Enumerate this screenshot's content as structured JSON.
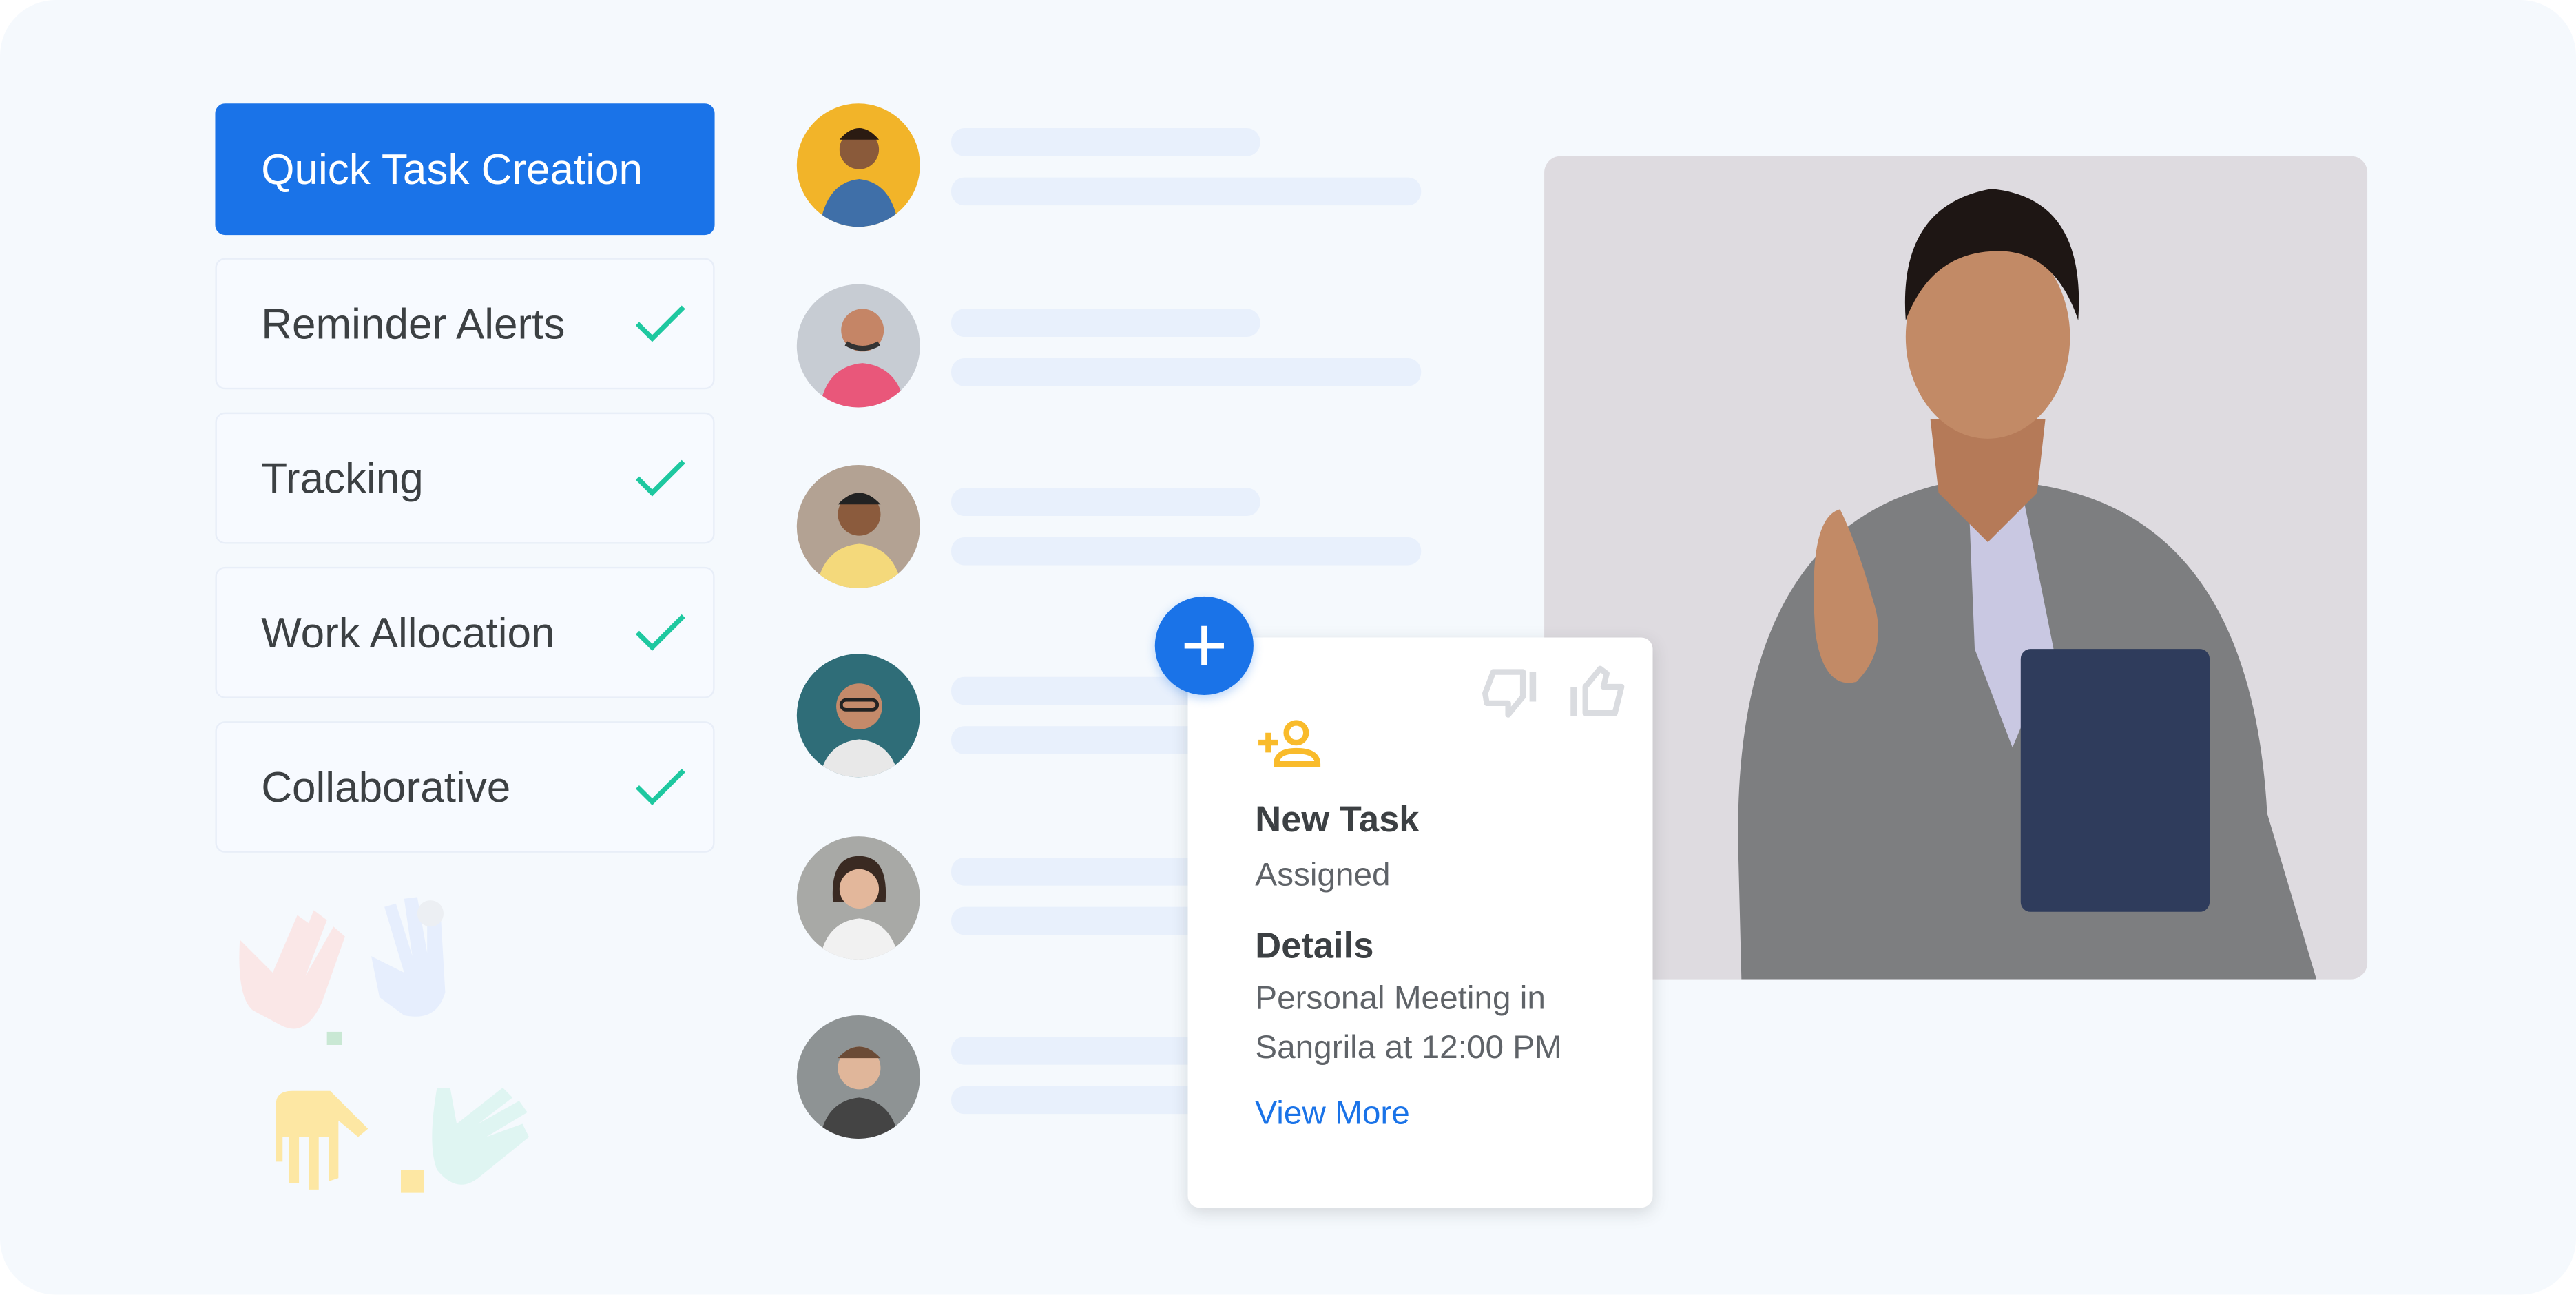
{
  "features": [
    {
      "label": "Quick Task Creation",
      "active": true,
      "checked": false
    },
    {
      "label": "Reminder Alerts",
      "active": false,
      "checked": true
    },
    {
      "label": "Tracking",
      "active": false,
      "checked": true
    },
    {
      "label": "Work Allocation",
      "active": false,
      "checked": true
    },
    {
      "label": "Collaborative",
      "active": false,
      "checked": true
    }
  ],
  "task_card": {
    "icon": "person-add-icon",
    "title": "New Task",
    "status": "Assigned",
    "details_heading": "Details",
    "details_line1": "Personal Meeting in",
    "details_line2": "Sangrila at 12:00 PM",
    "link": "View More"
  },
  "colors": {
    "accent": "#1a73e8",
    "check": "#1ec8a0",
    "task_icon": "#f9bb2b",
    "background": "#f5f9fd"
  }
}
